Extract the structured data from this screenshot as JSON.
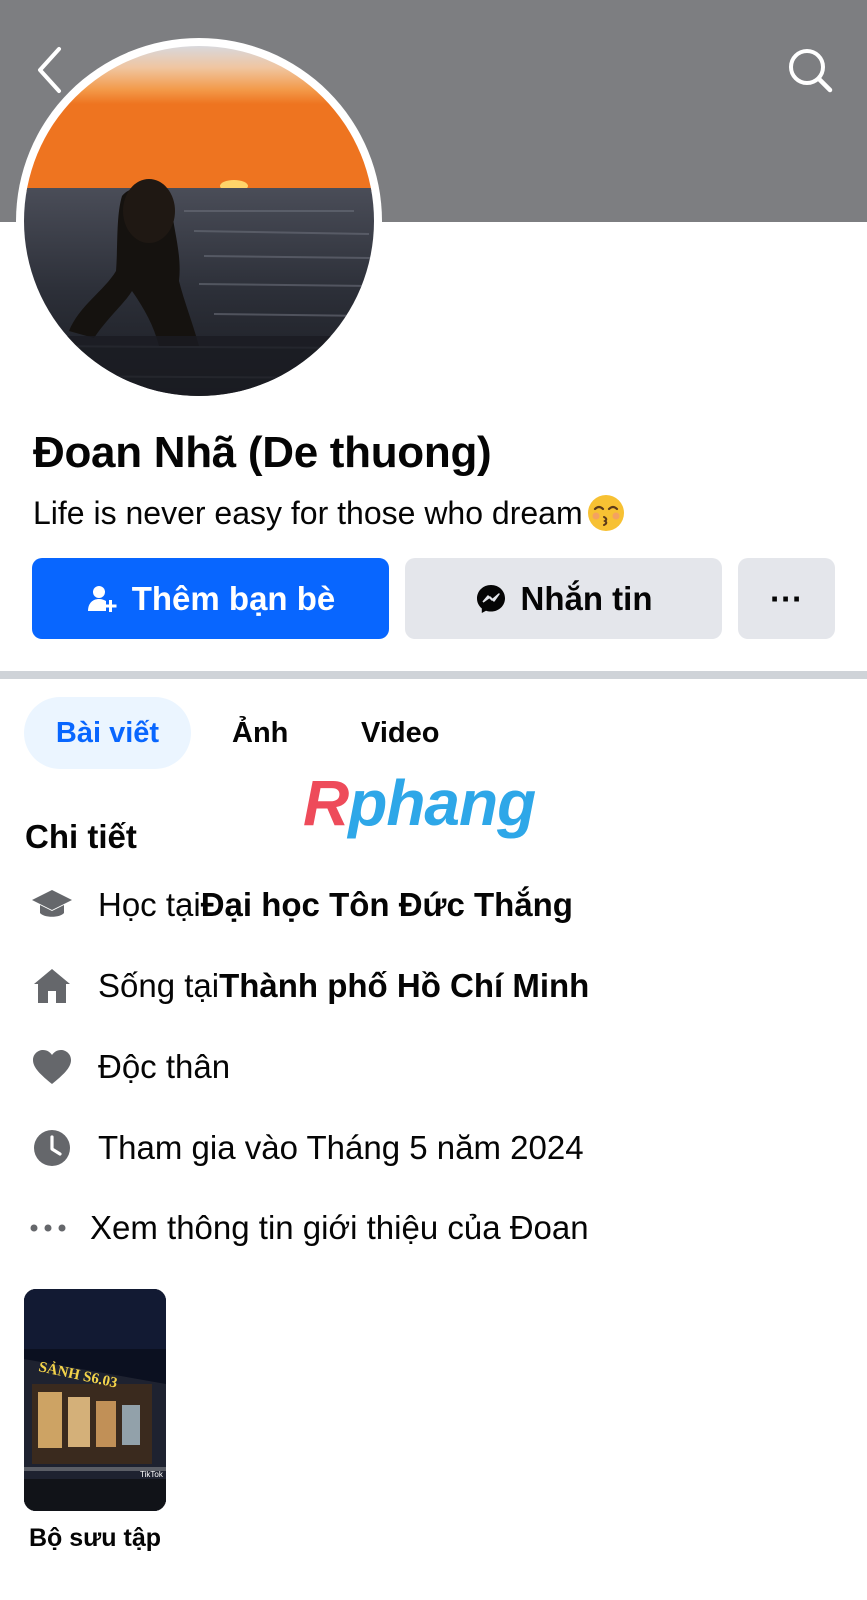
{
  "colors": {
    "accent": "#0866ff",
    "secondary_button": "#e4e6eb",
    "cover": "#7d7e81"
  },
  "header": {
    "back_icon": "chevron-left-icon",
    "search_icon": "search-icon"
  },
  "profile": {
    "name": "Đoan Nhã (De thuong)",
    "bio": "Life is never easy for those who dream",
    "bio_emoji": "kissing-face-closed-eyes-emoji"
  },
  "actions": {
    "add_friend": {
      "label": "Thêm bạn bè",
      "icon": "add-friend-icon"
    },
    "message": {
      "label": "Nhắn tin",
      "icon": "messenger-icon"
    },
    "more": {
      "label": "···",
      "icon": "more-icon"
    }
  },
  "tabs": [
    {
      "label": "Bài viết",
      "active": true
    },
    {
      "label": "Ảnh",
      "active": false
    },
    {
      "label": "Video",
      "active": false
    }
  ],
  "watermark": {
    "first": "R",
    "rest": "phang"
  },
  "details": {
    "title": "Chi tiết",
    "items": [
      {
        "icon": "graduation-cap-icon",
        "prefix": "Học tại ",
        "bold": "Đại học Tôn Đức Thắng"
      },
      {
        "icon": "home-icon",
        "prefix": "Sống tại ",
        "bold": "Thành phố Hồ Chí Minh"
      },
      {
        "icon": "heart-icon",
        "prefix": "Độc thân",
        "bold": ""
      },
      {
        "icon": "clock-icon",
        "prefix": "Tham gia vào Tháng 5 năm 2024",
        "bold": ""
      },
      {
        "icon": "more-dots-icon",
        "prefix": "Xem thông tin giới thiệu của Đoan",
        "bold": ""
      }
    ]
  },
  "collection": {
    "label": "Bộ sưu tập",
    "thumbnail_sign": "SẢNH S6.03",
    "thumbnail_watermark": "TikTok"
  }
}
